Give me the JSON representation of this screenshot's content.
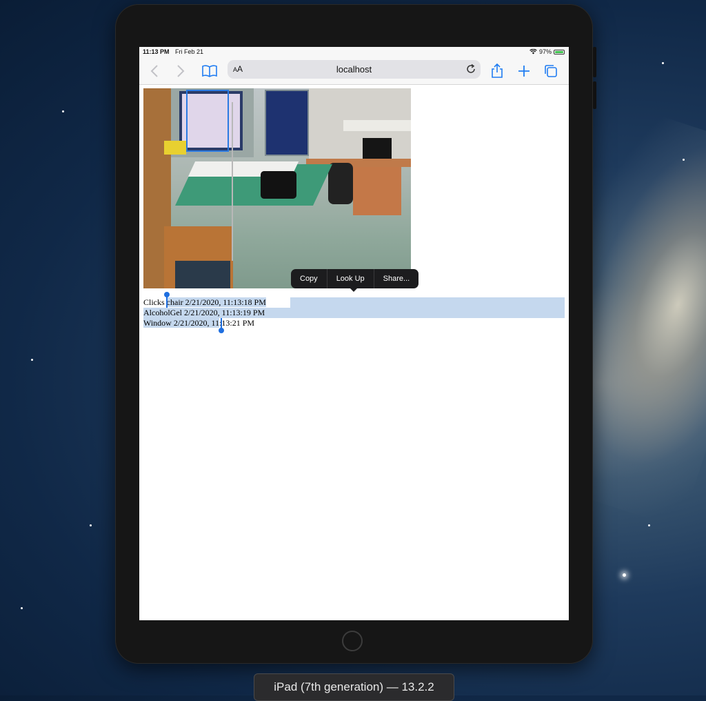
{
  "status_bar": {
    "time": "11:13 PM",
    "date": "Fri Feb 21",
    "battery": "97%"
  },
  "browser": {
    "reader_label_small": "A",
    "reader_label_large": "A",
    "url": "localhost",
    "icons": [
      "chevron-left-icon",
      "chevron-right-icon",
      "book-icon",
      "reload-icon",
      "share-icon",
      "plus-icon",
      "tabs-icon"
    ]
  },
  "context_menu": {
    "copy": "Copy",
    "look_up": "Look Up",
    "share": "Share..."
  },
  "log_lines": [
    {
      "name": "Clicks ",
      "selected_part": "chair 2/21/2020, 11:13:18 PM"
    },
    {
      "text": "AlcoholGel 2/21/2020, 11:13:19 PM"
    },
    {
      "selected_part": "Window 2/21/2020, 11",
      "rest": ":13:21 PM"
    }
  ],
  "device_label": "iPad (7th generation) — 13.2.2",
  "colors": {
    "accent": "#1f7cf2",
    "selection": "#c5d8ee",
    "menu": "#1c1c1e"
  }
}
